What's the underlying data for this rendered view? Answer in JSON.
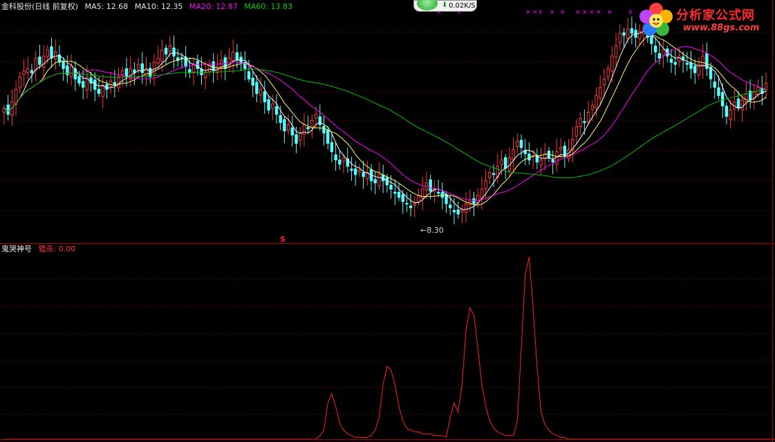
{
  "colors": {
    "background": "#000000",
    "rise": "#ff3a3a",
    "fall": "#54ffff",
    "ma5": "#ffffff",
    "ma10": "#ffff66",
    "ma20": "#ff00ff",
    "ma60": "#00c000",
    "grid": "#8b0000",
    "indicator": "#ff2020"
  },
  "main_panel": {
    "stock_name": "金科股份",
    "period": "(日线 前复权)",
    "ma5": "MA5: 12.68",
    "ma10": "MA10: 12.35",
    "ma20": "MA20: 12.87",
    "ma60": "MA60: 13.83",
    "low_marker": "8.30",
    "signal_marker": "S"
  },
  "indicator_panel": {
    "name": "鬼哭神号",
    "value_text": "猎杀: 0.00"
  },
  "speed_widget": {
    "icon": "down-arrow-icon",
    "text": "0.02K/S"
  },
  "logo": {
    "title": "分析家公式网",
    "url": "www.88gs.com"
  },
  "chart_data": [
    {
      "type": "candlestick",
      "title": "",
      "ylim": [
        7.4,
        18.1
      ],
      "series": [
        {
          "name": "MA5",
          "values": []
        },
        {
          "name": "MA10",
          "values": []
        },
        {
          "name": "MA20",
          "values": []
        },
        {
          "name": "MA60",
          "values": []
        }
      ],
      "close": [
        13.5,
        13.2,
        13.8,
        14.4,
        15.0,
        15.3,
        15.4,
        15.2,
        15.9,
        15.6,
        16.0,
        16.3,
        15.9,
        16.2,
        15.7,
        15.4,
        15.1,
        15.5,
        14.9,
        14.7,
        14.5,
        15.0,
        14.7,
        14.4,
        14.2,
        14.6,
        14.4,
        14.8,
        14.6,
        15.0,
        15.3,
        15.0,
        15.4,
        15.2,
        15.6,
        15.2,
        15.4,
        15.0,
        15.7,
        15.9,
        16.3,
        16.1,
        16.5,
        16.0,
        15.8,
        15.9,
        15.5,
        15.2,
        15.6,
        15.4,
        15.1,
        15.2,
        15.6,
        15.3,
        15.5,
        15.8,
        15.4,
        15.9,
        16.2,
        15.8,
        15.7,
        15.4,
        14.9,
        14.6,
        14.2,
        14.4,
        13.8,
        13.4,
        13.7,
        13.2,
        12.8,
        12.4,
        12.7,
        12.2,
        11.8,
        12.3,
        12.7,
        12.5,
        12.9,
        13.2,
        12.7,
        12.3,
        11.8,
        11.4,
        11.0,
        10.8,
        11.1,
        10.7,
        10.5,
        10.3,
        10.5,
        10.2,
        10.4,
        10.0,
        9.9,
        10.3,
        10.0,
        9.8,
        9.6,
        9.4,
        9.2,
        9.0,
        8.9,
        8.7,
        8.9,
        9.3,
        9.6,
        9.9,
        9.5,
        9.6,
        9.4,
        9.2,
        8.9,
        8.7,
        8.5,
        8.4,
        8.6,
        8.9,
        9.0,
        8.9,
        9.3,
        9.6,
        10.0,
        10.4,
        10.3,
        10.7,
        11.0,
        10.6,
        11.1,
        11.5,
        11.9,
        11.6,
        11.3,
        11.0,
        11.2,
        10.9,
        11.0,
        11.3,
        11.1,
        10.9,
        11.4,
        11.6,
        11.2,
        11.5,
        12.0,
        12.6,
        13.0,
        12.8,
        13.3,
        13.6,
        14.1,
        14.5,
        14.9,
        15.4,
        16.0,
        16.5,
        17.1,
        17.0,
        17.3,
        17.1,
        16.9,
        17.2,
        17.4,
        16.9,
        16.6,
        16.2,
        15.9,
        16.3,
        16.0,
        15.7,
        15.6,
        16.0,
        15.8,
        15.6,
        15.4,
        15.2,
        15.6,
        16.0,
        15.4,
        14.9,
        14.5,
        14.1,
        13.6,
        13.1,
        13.4,
        13.8,
        13.5,
        13.9,
        14.2,
        13.9,
        14.3,
        14.5,
        14.2,
        14.7
      ]
    },
    {
      "type": "line",
      "title": "",
      "series": [
        {
          "name": "猎杀",
          "values": [
            0,
            0,
            0,
            0,
            0,
            0,
            0,
            0,
            0,
            0,
            0,
            0,
            0,
            0,
            0,
            0,
            0,
            0,
            0,
            0,
            0,
            0,
            0,
            0,
            0,
            0,
            0,
            0,
            0,
            0,
            0,
            0,
            0,
            0,
            0,
            0,
            0,
            0,
            0,
            0,
            0,
            0,
            0,
            0,
            0,
            0,
            0,
            0,
            0,
            0,
            0,
            0,
            0,
            0,
            0,
            0,
            0,
            0,
            0,
            0,
            0,
            0,
            0,
            0,
            0,
            0,
            0,
            0,
            0,
            0,
            0,
            0,
            0,
            0,
            0,
            0,
            0,
            0,
            0,
            0,
            0.02,
            0.05,
            0.2,
            0.25,
            0.18,
            0.09,
            0.05,
            0.03,
            0.02,
            0.01,
            0.01,
            0.01,
            0.01,
            0.02,
            0.05,
            0.12,
            0.3,
            0.4,
            0.38,
            0.3,
            0.18,
            0.1,
            0.06,
            0.05,
            0.04,
            0.04,
            0.03,
            0.03,
            0.03,
            0.02,
            0.02,
            0.02,
            0.01,
            0.12,
            0.2,
            0.15,
            0.3,
            0.6,
            0.72,
            0.68,
            0.5,
            0.3,
            0.18,
            0.1,
            0.06,
            0.04,
            0.03,
            0.02,
            0.02,
            0.02,
            0.1,
            0.5,
            0.9,
            1.0,
            0.72,
            0.4,
            0.15,
            0.08,
            0.05,
            0.03,
            0.02,
            0.01,
            0.01,
            0,
            0,
            0,
            0,
            0,
            0,
            0,
            0,
            0,
            0,
            0,
            0,
            0,
            0,
            0,
            0,
            0,
            0,
            0,
            0,
            0,
            0,
            0,
            0,
            0,
            0,
            0,
            0,
            0,
            0,
            0,
            0,
            0,
            0,
            0,
            0,
            0,
            0,
            0,
            0,
            0,
            0,
            0,
            0,
            0,
            0,
            0,
            0,
            0,
            0,
            0,
            0,
            0,
            0,
            0,
            0,
            0,
            0,
            0,
            0,
            0,
            0,
            0,
            0,
            0,
            0,
            0,
            0,
            0,
            0,
            0,
            0,
            0,
            0,
            0,
            0
          ]
        }
      ]
    }
  ]
}
